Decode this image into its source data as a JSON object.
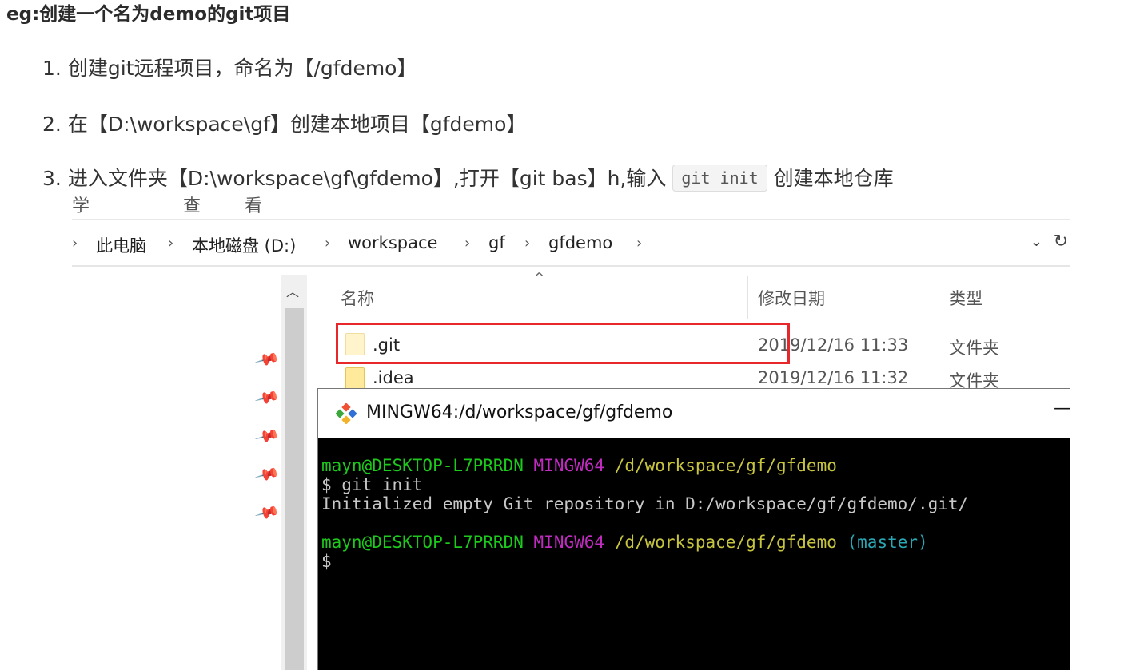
{
  "heading": "eg:创建一个名为demo的git项目",
  "steps": [
    {
      "num": "1.",
      "text": "创建git远程项目，命名为【/gfdemo】"
    },
    {
      "num": "2.",
      "text": "在【D:\\workspace\\gf】创建本地项目【gfdemo】"
    },
    {
      "num": "3.",
      "text_before": "进入文件夹【D:\\workspace\\gf\\gfdemo】,打开【git bas】h,输入",
      "code": "git init",
      "text_after": "创建本地仓库"
    }
  ],
  "explorer": {
    "cut_text": "学 查看",
    "breadcrumb": [
      "此电脑",
      "本地磁盘 (D:)",
      "workspace",
      "gf",
      "gfdemo"
    ],
    "columns": [
      "名称",
      "修改日期",
      "类型"
    ],
    "files": [
      {
        "name": ".git",
        "date": "2019/12/16 11:33",
        "type": "文件夹"
      },
      {
        "name": ".idea",
        "date": "2019/12/16 11:32",
        "type": "文件夹"
      }
    ],
    "highlight_color": "#e8272b"
  },
  "terminal": {
    "title": "MINGW64:/d/workspace/gf/gfdemo",
    "user": "mayn@DESKTOP-L7PRRDN",
    "env": "MINGW64",
    "path": "/d/workspace/gf/gfdemo",
    "branch": "(master)",
    "command": "$ git init",
    "output": "Initialized empty Git repository in D:/workspace/gf/gfdemo/.git/",
    "prompt": "$",
    "colors": {
      "user": "#1cc91c",
      "env": "#c02bc0",
      "path": "#c7c440",
      "branch": "#2aa7b4",
      "text": "#c8c8c8"
    }
  }
}
